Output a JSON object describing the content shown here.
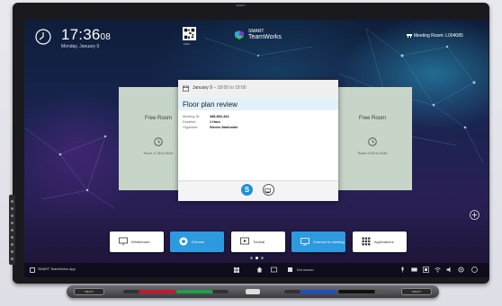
{
  "device": {
    "brand": "SMART"
  },
  "header": {
    "time": "17:36",
    "seconds": "08",
    "date": "Monday, January 9",
    "qr_code_id": "1234",
    "logo_line1": "SMART",
    "logo_line2": "TeamWorks",
    "meeting_room_label": "Meeting Room: L004085"
  },
  "left_card": {
    "status": "Free Room",
    "range": "Room 17:36 to 18:00"
  },
  "right_card": {
    "status": "Free Room",
    "range": "Room 19:00 to 23:59"
  },
  "meeting": {
    "date": "January 9",
    "range": " – 18:00 to 19:00",
    "title": "Floor plan review",
    "id_label": "Meeting ID:",
    "id_value": "498-892-324",
    "duration_label": "Duration:",
    "duration_value": "1 Hour",
    "organizer_label": "Organizer:",
    "organizer_value": "Steven Marinoide"
  },
  "actions": [
    {
      "label": "Whiteboard",
      "icon": "whiteboard-icon"
    },
    {
      "label": "Chrome",
      "icon": "chrome-icon"
    },
    {
      "label": "Tutorial",
      "icon": "tutorial-icon"
    },
    {
      "label": "Connect to meeting",
      "icon": "connect-icon"
    },
    {
      "label": "Applications",
      "icon": "applications-icon"
    }
  ],
  "pagination": {
    "current_page": 2,
    "total_pages": 3
  },
  "taskbar": {
    "app_name": "SMART TeamWorks App",
    "end_session": "End session"
  },
  "tray": {
    "left_button": "SMART",
    "right_button": "SMART"
  },
  "colors": {
    "accent_blue": "#2d9ae0",
    "card_green": "#c7d5c8",
    "skype_blue": "#1e90d6"
  }
}
